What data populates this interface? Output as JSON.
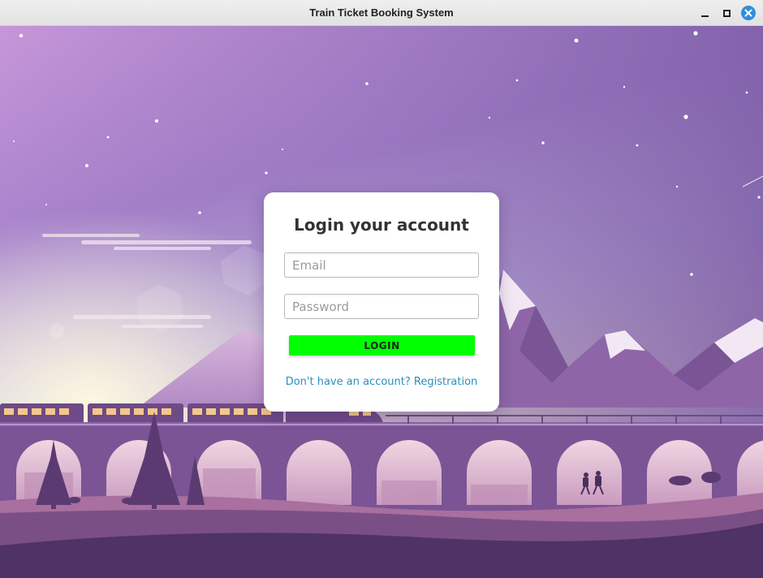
{
  "window": {
    "title": "Train Ticket Booking System",
    "controls": {
      "minimize": "minimize-icon",
      "maximize": "maximize-icon",
      "close": "close-icon"
    }
  },
  "login": {
    "heading": "Login your account",
    "email_placeholder": "Email",
    "email_value": "",
    "password_placeholder": "Password",
    "password_value": "",
    "login_label": "LOGIN",
    "register_link": "Don't have an account? Registration"
  },
  "colors": {
    "login_button": "#00ff00",
    "link": "#2a8fc0",
    "sky_top": "#a279c9",
    "sky_horizon": "#f3f1c4",
    "mountain": "#8e66a8",
    "ground": "#5a3b72"
  }
}
